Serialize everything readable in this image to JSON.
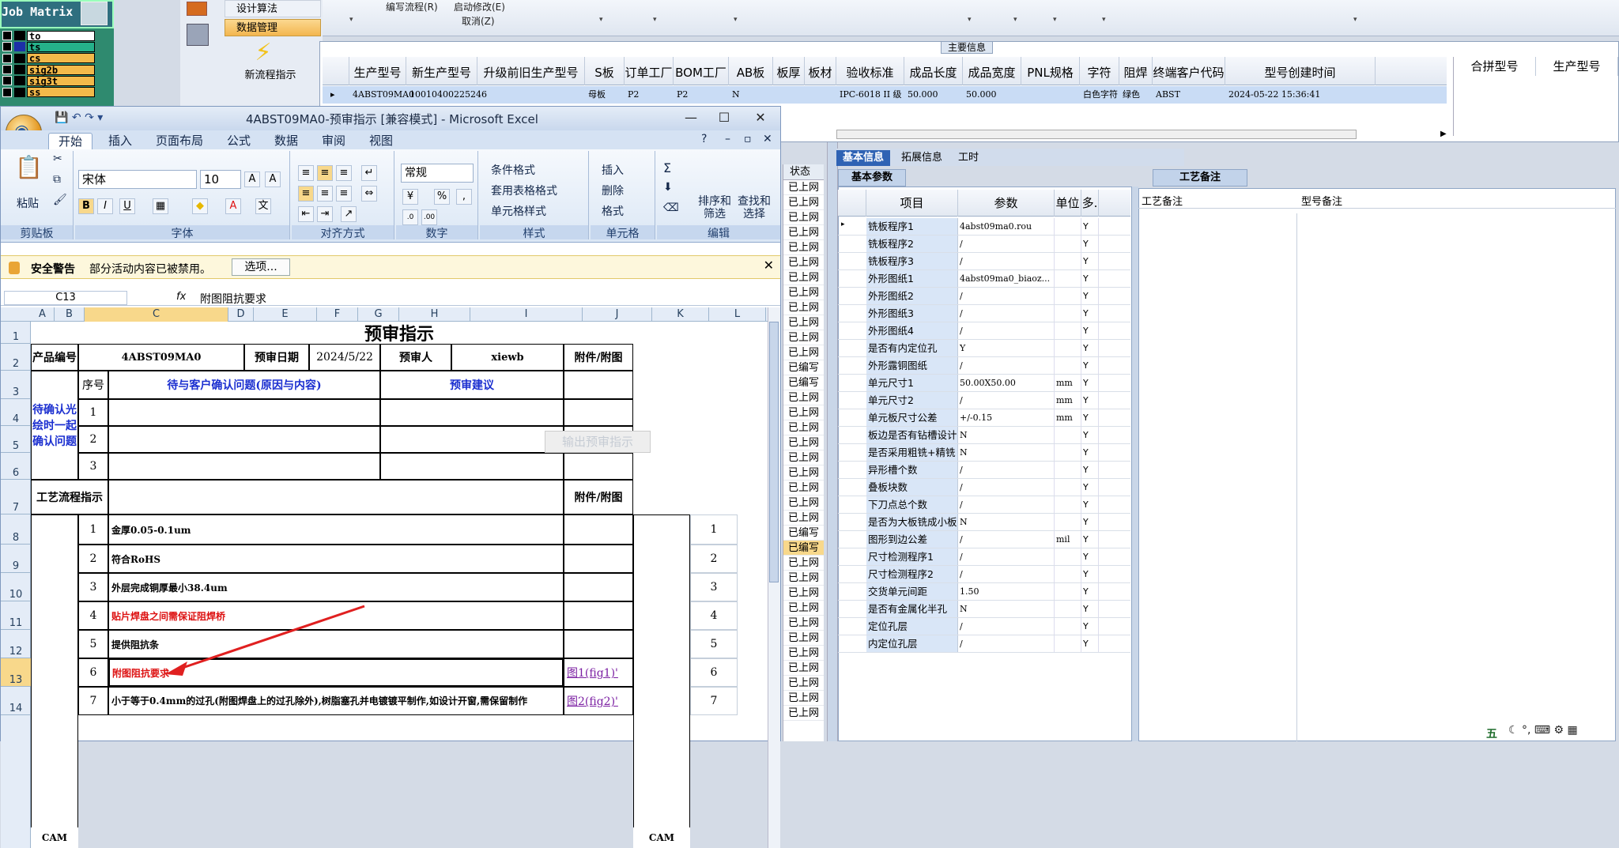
{
  "jobmatrix": {
    "title": "Job Matrix ...",
    "layers": [
      {
        "name": "to",
        "color": "#ffffff"
      },
      {
        "name": "ts",
        "color": "#25b18a"
      },
      {
        "name": "cs",
        "color": "#f3b94a"
      },
      {
        "name": "sig2b",
        "color": "#f3b94a"
      },
      {
        "name": "sig3t",
        "color": "#f3b94a"
      },
      {
        "name": "ss",
        "color": "#f3b94a"
      }
    ]
  },
  "nav": {
    "items": [
      "设计算法",
      "数据管理"
    ],
    "newflow": "新流程指示"
  },
  "toolbar": {
    "items": [
      "编写流程(R)",
      "启动修改(E)",
      "取消(Z)"
    ]
  },
  "maininfo": {
    "caption": "主要信息",
    "columns": [
      "生产型号",
      "新生产型号",
      "升级前旧生产型号",
      "S板",
      "订单工厂",
      "BOM工厂",
      "AB板",
      "板厚",
      "板材",
      "验收标准",
      "成品长度",
      "成品宽度",
      "PNL规格",
      "字符",
      "阻焊",
      "终端客户代码",
      "型号创建时间"
    ],
    "row": [
      "4ABST09MA0",
      "10010400225246",
      "",
      "母板",
      "P2",
      "P2",
      "N",
      "",
      "",
      "IPC-6018 II 级",
      "50.000",
      "50.000",
      "",
      "白色字符",
      "绿色",
      "ABST",
      "2024-05-22 15:36:41"
    ],
    "right_columns": [
      "合拼型号",
      "生产型号"
    ]
  },
  "excel": {
    "title": "4ABST09MA0-预审指示 [兼容模式] - Microsoft Excel",
    "tabs": [
      "开始",
      "插入",
      "页面布局",
      "公式",
      "数据",
      "审阅",
      "视图"
    ],
    "groups": {
      "clipboard": "剪贴板",
      "font": "字体",
      "align": "对齐方式",
      "number": "数字",
      "style": "样式",
      "cells": "单元格",
      "edit": "编辑"
    },
    "paste": "粘贴",
    "font_name": "宋体",
    "font_size": "10",
    "number_format": "常规",
    "style_items": [
      "条件格式",
      "套用表格格式",
      "单元格样式"
    ],
    "cell_items": [
      "插入",
      "删除",
      "格式"
    ],
    "edit_items": [
      "排序和筛选",
      "查找和选择"
    ],
    "security": {
      "title": "安全警告",
      "msg": "部分活动内容已被禁用。",
      "options": "选项..."
    },
    "namebox": "C13",
    "formula": "附图阻抗要求",
    "columns": [
      "A",
      "B",
      "C",
      "D",
      "E",
      "F",
      "G",
      "H",
      "I",
      "J",
      "K",
      "L"
    ],
    "rows": [
      "1",
      "2",
      "3",
      "4",
      "5",
      "6",
      "7",
      "8",
      "9",
      "10",
      "11",
      "12",
      "13",
      "14"
    ],
    "sheet": {
      "title": "预审指示",
      "export_btn": "输出预审指示",
      "prod_label": "产品编号",
      "prod_no": "4ABST09MA0",
      "date_label": "预审日期",
      "date": "2024/5/22",
      "reviewer_label": "预审人",
      "reviewer": "xiewb",
      "attach_label": "附件/附图",
      "confirm_label": "待确认光绘时一起确认问题",
      "seq_label": "序号",
      "issue_label": "待与客户确认问题(原因与内容)",
      "advice_label": "预审建议",
      "q_rows": [
        "1",
        "2",
        "3"
      ],
      "flow_label": "工艺流程指示",
      "flow_attach": "附件/附图",
      "items": [
        {
          "n": "1",
          "text": "金厚0.05-0.1um",
          "style": "",
          "link": "",
          "right": "1"
        },
        {
          "n": "2",
          "text": "符合RoHS",
          "style": "",
          "link": "",
          "right": "2"
        },
        {
          "n": "3",
          "text": "外层完成铜厚最小38.4um",
          "style": "",
          "link": "",
          "right": "3"
        },
        {
          "n": "4",
          "text": "贴片焊盘之间需保证阻焊桥",
          "style": "red",
          "link": "",
          "right": "4"
        },
        {
          "n": "5",
          "text": "提供阻抗条",
          "style": "",
          "link": "",
          "right": "5"
        },
        {
          "n": "6",
          "text": "附图阻抗要求",
          "style": "red",
          "link": "图1(fig1)'",
          "right": "6"
        },
        {
          "n": "7",
          "text": "小于等于0.4mm的过孔(附图焊盘上的过孔除外),树脂塞孔并电镀镀平制作,如设计开窗,需保留制作",
          "style": "",
          "link": "图2(fig2)'",
          "right": "7"
        }
      ],
      "cam_label": "CAM"
    }
  },
  "status": {
    "header": "状态",
    "values": [
      "已上网",
      "已上网",
      "已上网",
      "已上网",
      "已上网",
      "已上网",
      "已上网",
      "已上网",
      "已上网",
      "已上网",
      "已上网",
      "已上网",
      "已编写",
      "已编写",
      "已上网",
      "已上网",
      "已上网",
      "已上网",
      "已上网",
      "已上网",
      "已上网",
      "已上网",
      "已上网",
      "已编写",
      "已编写",
      "已上网",
      "已上网",
      "已上网",
      "已上网",
      "已上网",
      "已上网",
      "已上网",
      "已上网",
      "已上网",
      "已上网",
      "已上网"
    ]
  },
  "basic": {
    "tabs": [
      "基本信息",
      "拓展信息",
      "工时"
    ],
    "subtab": "基本参数",
    "columns": [
      "项目",
      "参数",
      "单位",
      "多."
    ],
    "rows": [
      {
        "k": "铣板程序1",
        "v": "4abst09ma0.rou",
        "u": "",
        "y": "Y"
      },
      {
        "k": "铣板程序2",
        "v": "/",
        "u": "",
        "y": "Y"
      },
      {
        "k": "铣板程序3",
        "v": "/",
        "u": "",
        "y": "Y"
      },
      {
        "k": "外形图纸1",
        "v": "4abst09ma0_biaoz...",
        "u": "",
        "y": "Y"
      },
      {
        "k": "外形图纸2",
        "v": "/",
        "u": "",
        "y": "Y"
      },
      {
        "k": "外形图纸3",
        "v": "/",
        "u": "",
        "y": "Y"
      },
      {
        "k": "外形图纸4",
        "v": "/",
        "u": "",
        "y": "Y"
      },
      {
        "k": "是否有内定位孔",
        "v": "Y",
        "u": "",
        "y": "Y"
      },
      {
        "k": "外形露铜图纸",
        "v": "/",
        "u": "",
        "y": "Y"
      },
      {
        "k": "单元尺寸1",
        "v": "50.00X50.00",
        "u": "mm",
        "y": "Y"
      },
      {
        "k": "单元尺寸2",
        "v": "/",
        "u": "mm",
        "y": "Y"
      },
      {
        "k": "单元板尺寸公差",
        "v": "+/-0.15",
        "u": "mm",
        "y": "Y"
      },
      {
        "k": "板边是否有钻槽设计",
        "v": "N",
        "u": "",
        "y": "Y"
      },
      {
        "k": "是否采用粗铣+精铣",
        "v": "N",
        "u": "",
        "y": "Y"
      },
      {
        "k": "异形槽个数",
        "v": "/",
        "u": "",
        "y": "Y"
      },
      {
        "k": "叠板块数",
        "v": "/",
        "u": "",
        "y": "Y"
      },
      {
        "k": "下刀点总个数",
        "v": "/",
        "u": "",
        "y": "Y"
      },
      {
        "k": "是否为大板铣成小板",
        "v": "N",
        "u": "",
        "y": "Y"
      },
      {
        "k": "图形到边公差",
        "v": "/",
        "u": "mil",
        "y": "Y"
      },
      {
        "k": "尺寸检测程序1",
        "v": "/",
        "u": "",
        "y": "Y"
      },
      {
        "k": "尺寸检测程序2",
        "v": "/",
        "u": "",
        "y": "Y"
      },
      {
        "k": "交货单元间距",
        "v": "1.50",
        "u": "",
        "y": "Y"
      },
      {
        "k": "是否有金属化半孔",
        "v": "N",
        "u": "",
        "y": "Y"
      },
      {
        "k": "定位孔层",
        "v": "/",
        "u": "",
        "y": "Y"
      },
      {
        "k": "内定位孔层",
        "v": "/",
        "u": "",
        "y": "Y"
      }
    ]
  },
  "craft": {
    "tab": "工艺备注",
    "h1": "工艺备注",
    "h2": "型号备注"
  },
  "ime": "五"
}
